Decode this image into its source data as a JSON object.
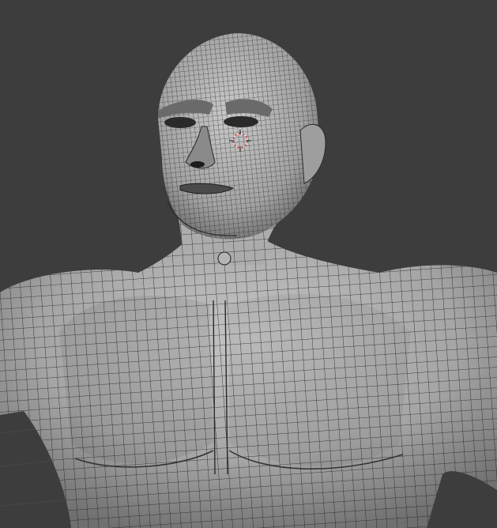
{
  "viewport": {
    "mode": "edit-mode-wireframe",
    "background_color": "#3d3d3d",
    "mesh_color": "#a9a9a9",
    "wire_color": "#1e1e1e",
    "cursor_color": "#d9484b",
    "icons": {
      "model": "character-mesh-icon",
      "cursor": "3d-cursor-icon"
    }
  }
}
